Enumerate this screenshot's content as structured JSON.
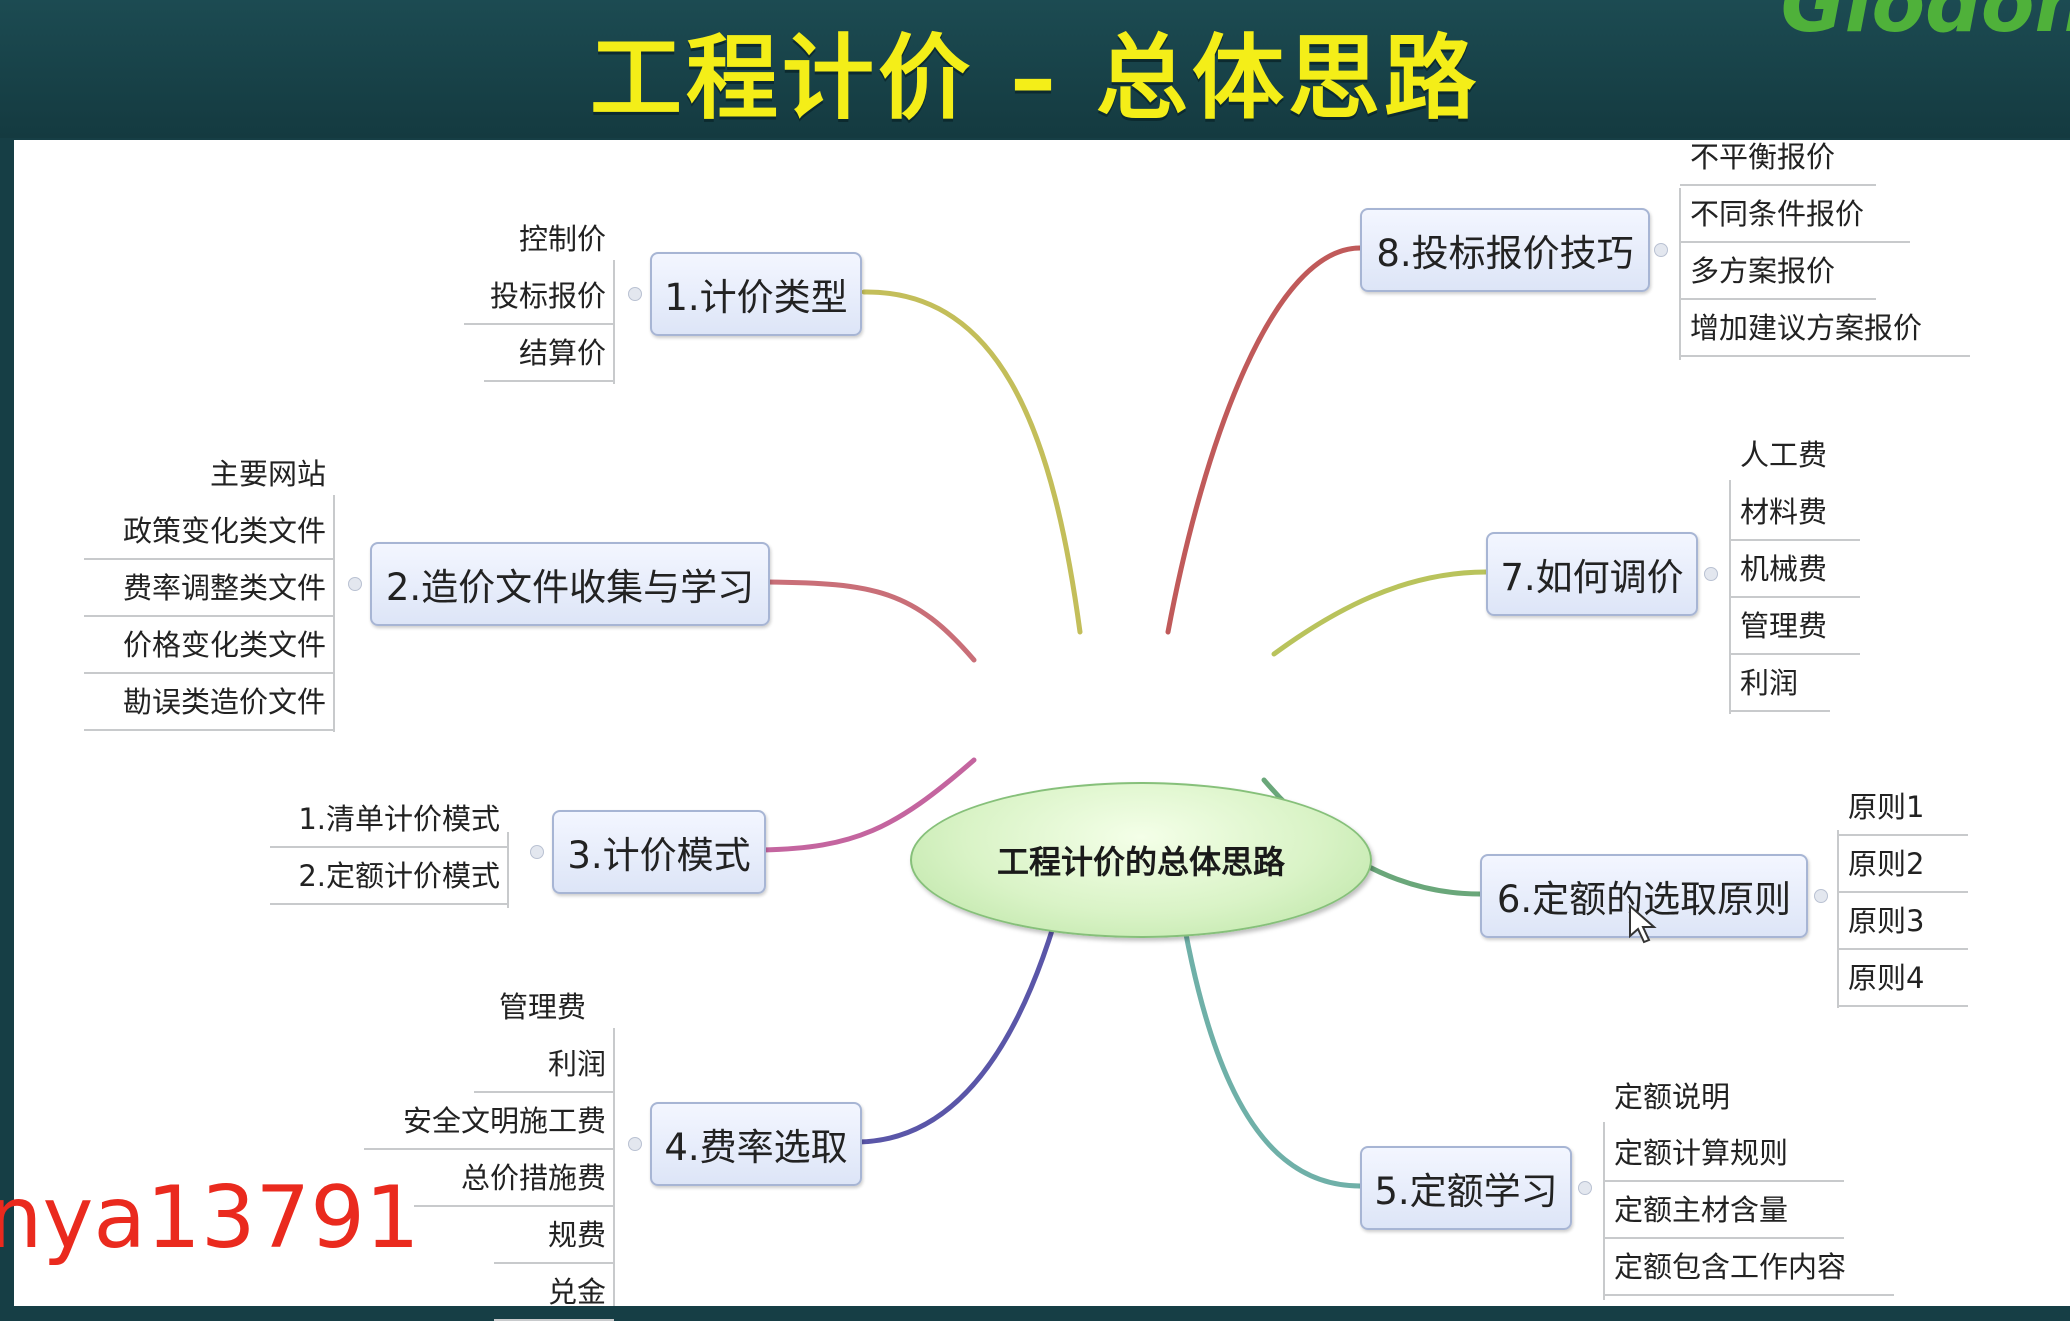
{
  "header": {
    "title": "工程计价 – 总体思路",
    "logo": "Glodon"
  },
  "center": "工程计价的总体思路",
  "branches": [
    {
      "label": "1.计价类型",
      "leaves": [
        "控制价",
        "投标报价",
        "结算价"
      ]
    },
    {
      "label": "2.造价文件收集与学习",
      "leaves": [
        "主要网站",
        "政策变化类文件",
        "费率调整类文件",
        "价格变化类文件",
        "勘误类造价文件"
      ]
    },
    {
      "label": "3.计价模式",
      "leaves": [
        "1.清单计价模式",
        "2.定额计价模式"
      ]
    },
    {
      "label": "4.费率选取",
      "leaves": [
        "管理费",
        "利润",
        "安全文明施工费",
        "总价措施费",
        "规费",
        "兑金"
      ]
    },
    {
      "label": "5.定额学习",
      "leaves": [
        "定额说明",
        "定额计算规则",
        "定额主材含量",
        "定额包含工作内容"
      ]
    },
    {
      "label": "6.定额的选取原则",
      "leaves": [
        "原则1",
        "原则2",
        "原则3",
        "原则4"
      ]
    },
    {
      "label": "7.如何调价",
      "leaves": [
        "人工费",
        "材料费",
        "机械费",
        "管理费",
        "利润"
      ]
    },
    {
      "label": "8.投标报价技巧",
      "leaves": [
        "不平衡报价",
        "不同条件报价",
        "多方案报价",
        "增加建议方案报价"
      ]
    }
  ],
  "branch_colors": [
    "#c3be5a",
    "#c96f78",
    "#c4659f",
    "#5a56a8",
    "#6fb0a8",
    "#6aa77a",
    "#b9c35c",
    "#c05a5a"
  ],
  "watermark": "nya13791",
  "icons": {
    "cursor": "mouse-pointer-icon"
  }
}
